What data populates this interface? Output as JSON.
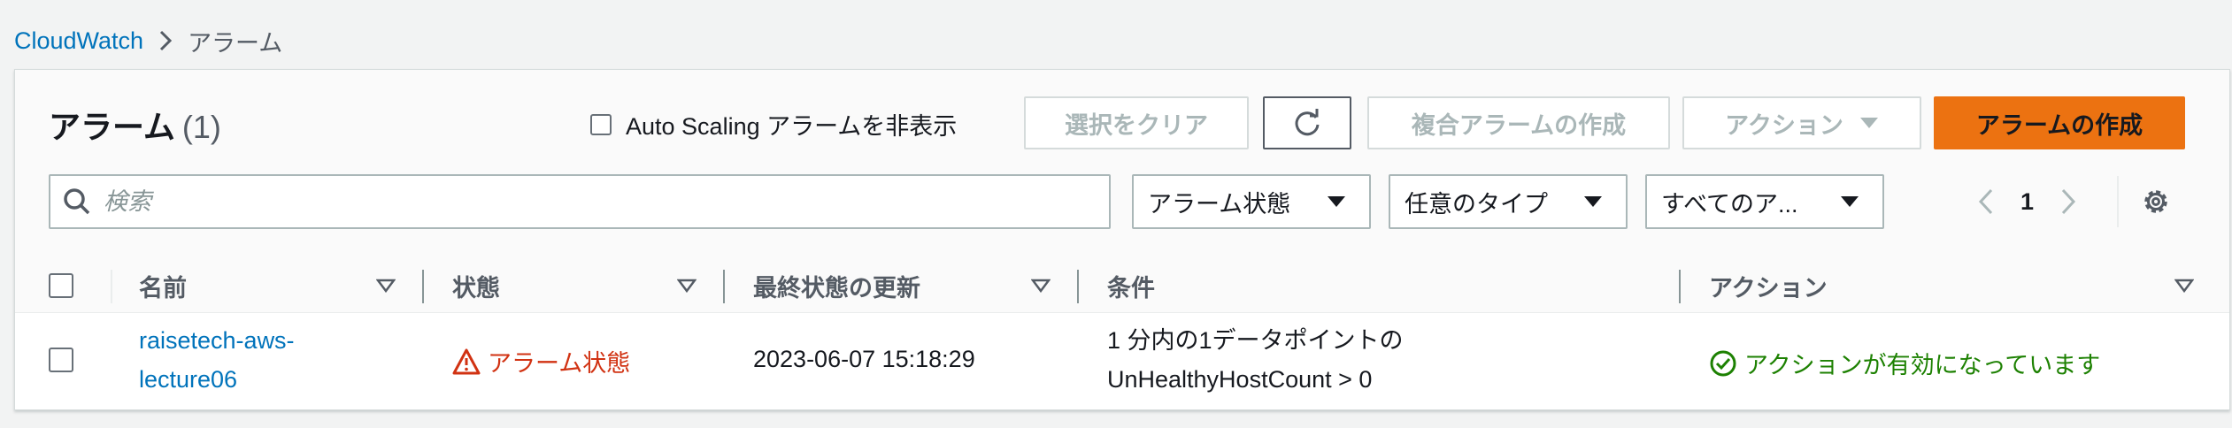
{
  "breadcrumb": {
    "root": "CloudWatch",
    "current": "アラーム"
  },
  "header": {
    "title": "アラーム",
    "count": "(1)"
  },
  "toolbar": {
    "hide_asg_label": "Auto Scaling アラームを非表示",
    "clear_selection": "選択をクリア",
    "create_composite": "複合アラームの作成",
    "actions": "アクション",
    "create_alarm": "アラームの作成"
  },
  "filters": {
    "search_placeholder": "検索",
    "state_select": "アラーム状態",
    "type_select": "任意のタイプ",
    "actions_select": "すべてのア..."
  },
  "pagination": {
    "page": "1"
  },
  "table": {
    "columns": [
      "名前",
      "状態",
      "最終状態の更新",
      "条件",
      "アクション"
    ],
    "rows": [
      {
        "name_line1": "raisetech-aws-",
        "name_line2": "lecture06",
        "state": "アラーム状態",
        "last_update": "2023-06-07 15:18:29",
        "condition_line1": "1 分内の1データポイントの",
        "condition_line2": "UnHealthyHostCount > 0",
        "actions": "アクションが有効になっています"
      }
    ]
  },
  "colors": {
    "link": "#0073bb",
    "primary": "#ec7211",
    "alarm": "#d13212",
    "ok": "#1d8102"
  }
}
